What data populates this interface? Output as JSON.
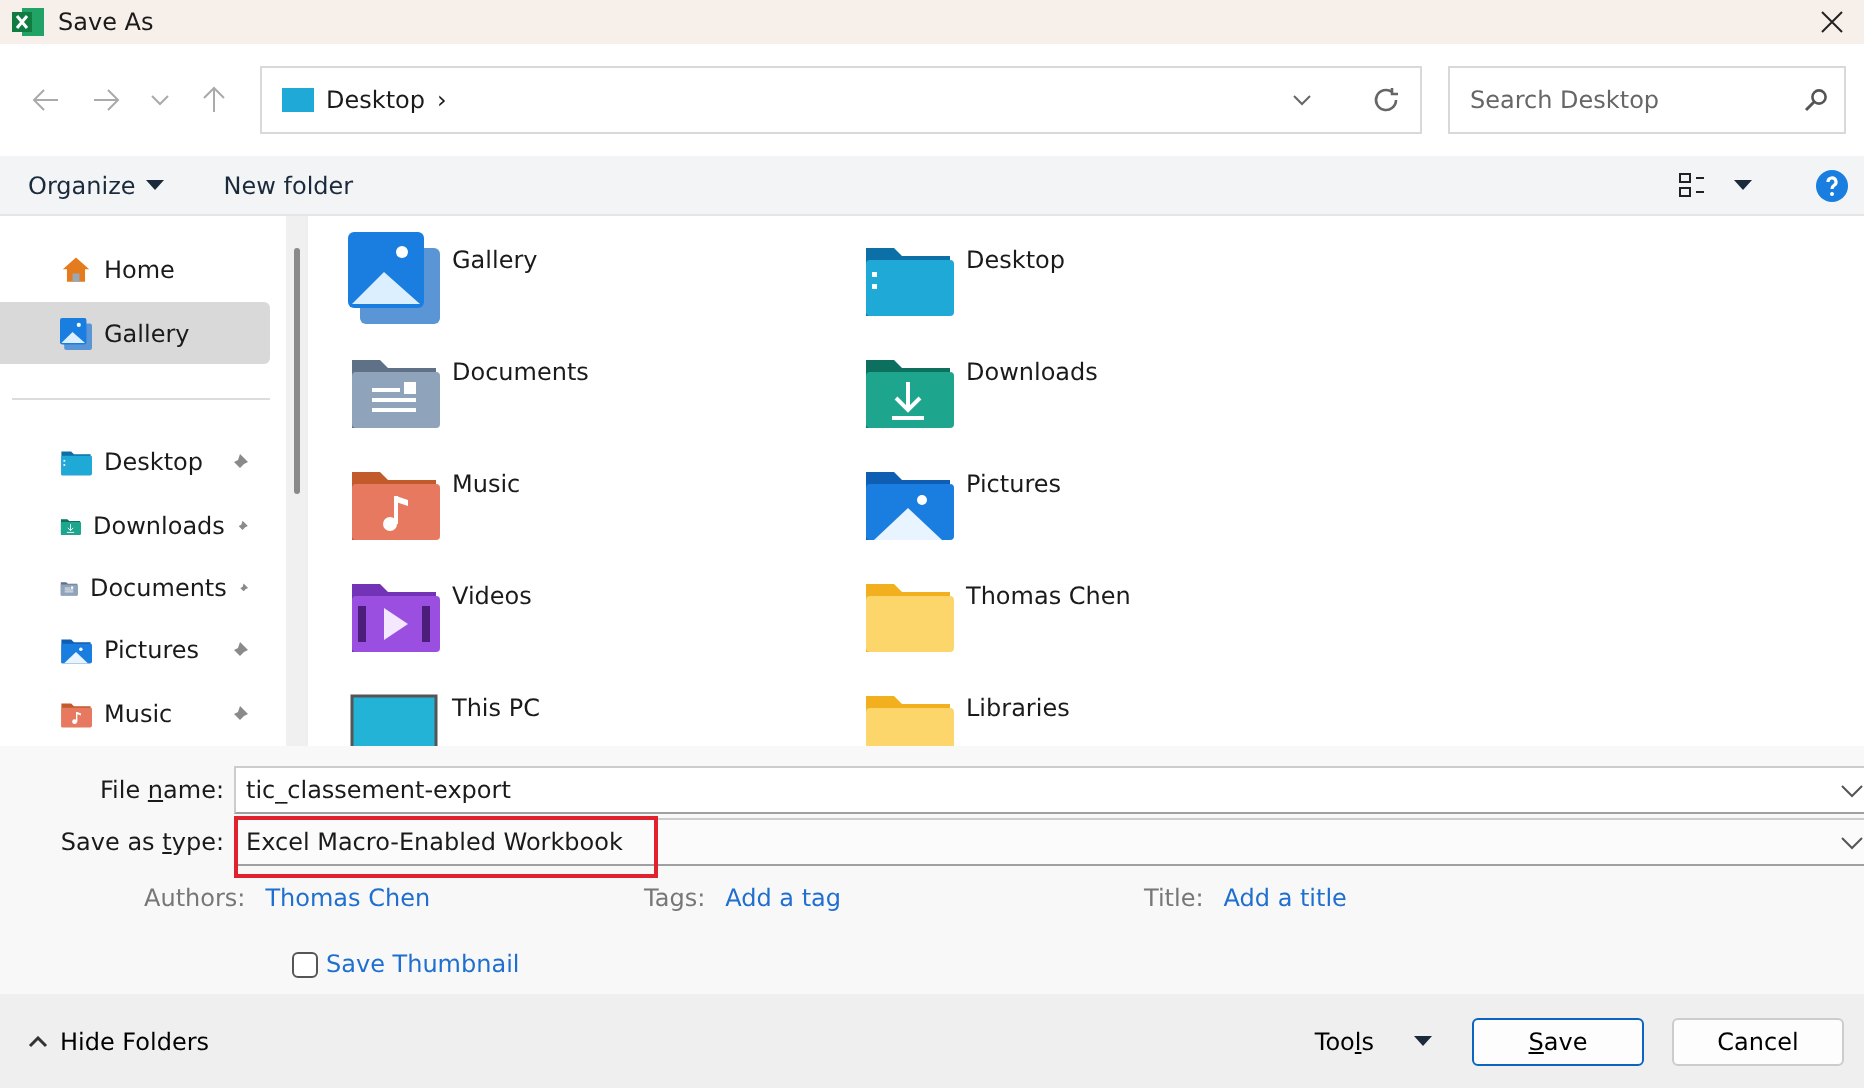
{
  "window": {
    "title": "Save As"
  },
  "address": {
    "location": "Desktop",
    "separator": "›"
  },
  "search": {
    "placeholder": "Search Desktop"
  },
  "toolbar": {
    "organize": "Organize",
    "new_folder": "New folder"
  },
  "sidebar": {
    "top": [
      {
        "label": "Home",
        "kind": "home",
        "selected": false
      },
      {
        "label": "Gallery",
        "kind": "gallery",
        "selected": true
      }
    ],
    "quick_access": [
      {
        "label": "Desktop",
        "kind": "desktop",
        "selected": false,
        "pinned": true
      },
      {
        "label": "Downloads",
        "kind": "downloads",
        "selected": false,
        "pinned": true
      },
      {
        "label": "Documents",
        "kind": "documents",
        "selected": false,
        "pinned": true
      },
      {
        "label": "Pictures",
        "kind": "pictures",
        "selected": false,
        "pinned": true
      },
      {
        "label": "Music",
        "kind": "music",
        "selected": false,
        "pinned": true
      }
    ]
  },
  "items": [
    {
      "label": "Gallery",
      "kind": "gallery"
    },
    {
      "label": "Desktop",
      "kind": "desktop"
    },
    {
      "label": "Documents",
      "kind": "documents"
    },
    {
      "label": "Downloads",
      "kind": "downloads"
    },
    {
      "label": "Music",
      "kind": "music"
    },
    {
      "label": "Pictures",
      "kind": "pictures"
    },
    {
      "label": "Videos",
      "kind": "videos"
    },
    {
      "label": "Thomas Chen",
      "kind": "folder"
    },
    {
      "label": "This PC",
      "kind": "pc"
    },
    {
      "label": "Libraries",
      "kind": "folder"
    }
  ],
  "form": {
    "file_name": {
      "label": {
        "before": "File ",
        "key": "n",
        "after": "ame:"
      },
      "value": "tic_classement-export"
    },
    "save_as_type": {
      "label": {
        "before": "Save as ",
        "key": "t",
        "after": "ype:"
      },
      "value": "Excel Macro-Enabled Workbook",
      "highlighted": true
    },
    "meta": [
      {
        "label": "Authors:",
        "value": "Thomas Chen"
      },
      {
        "label": "Tags:",
        "value": "Add a tag"
      },
      {
        "label": "Title:",
        "value": "Add a title"
      }
    ],
    "save_thumbnail": {
      "label": "Save Thumbnail",
      "checked": false
    }
  },
  "footer": {
    "hide_folders": "Hide Folders",
    "tools": {
      "before": "Too",
      "key": "l",
      "after": "s"
    },
    "save": {
      "key": "S",
      "after": "ave"
    },
    "cancel": "Cancel"
  }
}
